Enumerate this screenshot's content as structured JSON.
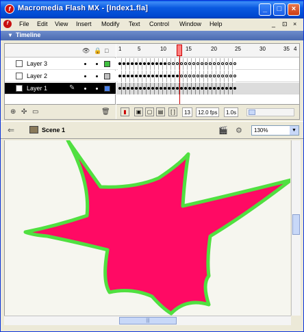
{
  "window": {
    "title": "Macromedia Flash MX - [Index1.fla]",
    "app_icon": "f",
    "buttons": [
      "minimize",
      "maximize",
      "close"
    ]
  },
  "menubar": {
    "items": [
      "File",
      "Edit",
      "View",
      "Insert",
      "Modify",
      "Text",
      "Control",
      "Window",
      "Help"
    ],
    "mdi_buttons": [
      "_",
      "⊡",
      "×"
    ]
  },
  "timeline": {
    "header_label": "Timeline",
    "ruler": [
      "1",
      "5",
      "10",
      "15",
      "20",
      "25",
      "30",
      "35",
      "4"
    ],
    "layers": [
      {
        "name": "Layer 3",
        "color": "#40c040",
        "selected": false
      },
      {
        "name": "Layer 2",
        "color": "#c0c0c0",
        "selected": false
      },
      {
        "name": "Layer 1",
        "color": "#4a80e8",
        "selected": true
      }
    ],
    "current_frame": "13",
    "frame_rate": "12.0 fps",
    "time": "1.0s"
  },
  "scene": {
    "label": "Scene 1",
    "zoom": "130%"
  },
  "stage": {
    "shape_fill": "#ff0a64",
    "shape_stroke": "#50e040",
    "background": "#f6f6ef"
  }
}
